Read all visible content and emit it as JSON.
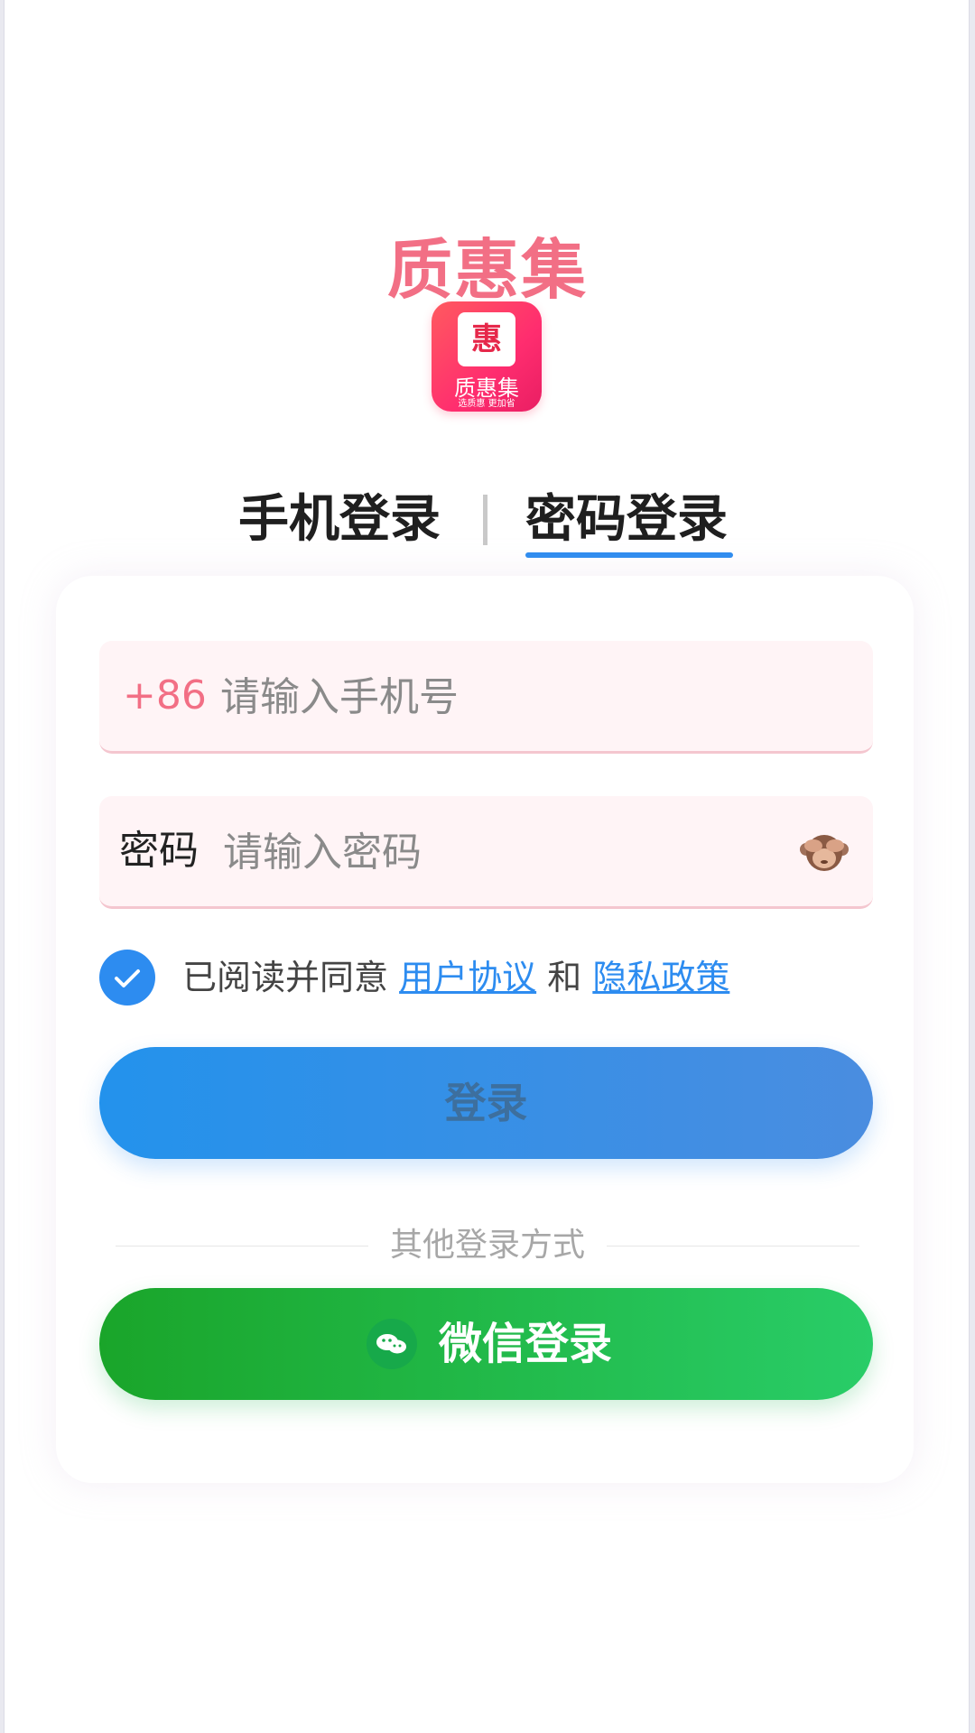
{
  "brand": {
    "title": "质惠集",
    "icon_char": "惠",
    "icon_caption": "质惠集",
    "icon_subcaption": "选质惠 更加省"
  },
  "tabs": [
    {
      "label": "手机登录",
      "active": false
    },
    {
      "label": "密码登录",
      "active": true
    }
  ],
  "phone_field": {
    "prefix": "+86",
    "placeholder": "请输入手机号",
    "value": ""
  },
  "password_field": {
    "prefix": "密码",
    "placeholder": "请输入密码",
    "value": "",
    "toggle_icon": "see-no-evil-monkey-icon"
  },
  "agreement": {
    "checked": true,
    "text": "已阅读并同意",
    "user_agreement": "用户协议",
    "and": "和",
    "privacy_policy": "隐私政策"
  },
  "login_button": {
    "label": "登录"
  },
  "other_methods": {
    "label": "其他登录方式"
  },
  "wechat_button": {
    "label": "微信登录",
    "icon": "wechat-icon"
  },
  "colors": {
    "brand": "#f26f85",
    "primary": "#2d8cf0",
    "wechat": "#1fb84a",
    "field_bg": "#fff4f6"
  }
}
